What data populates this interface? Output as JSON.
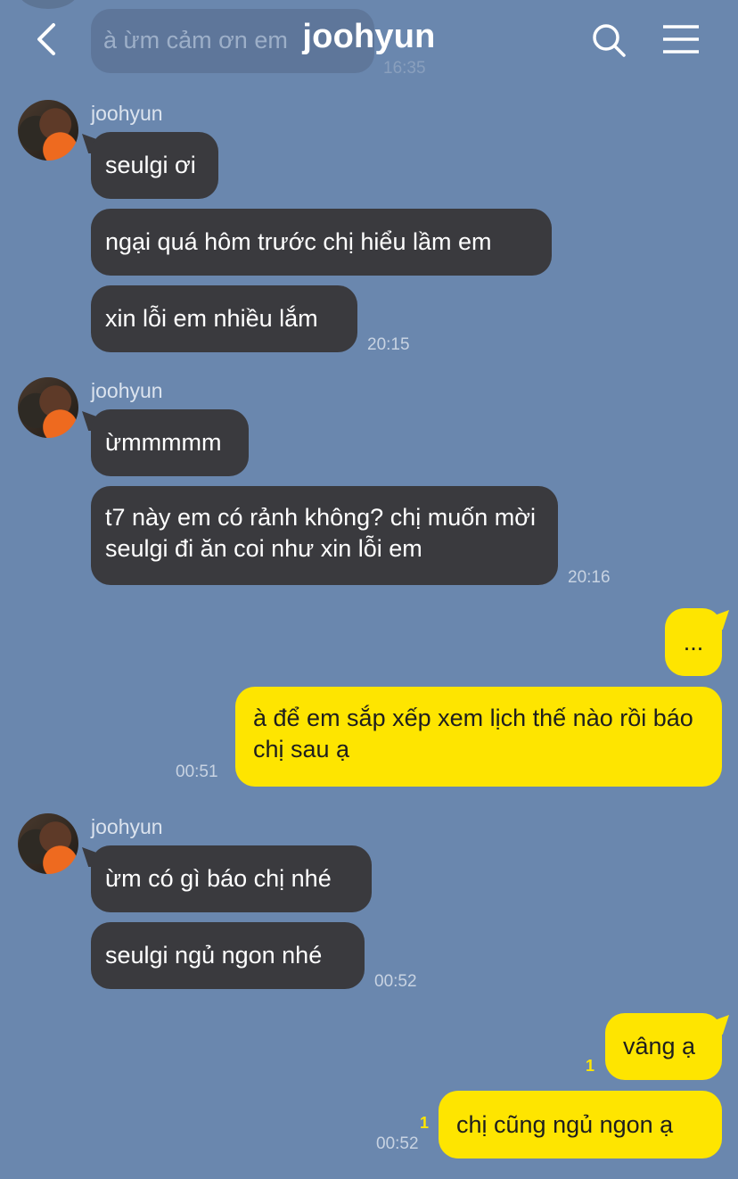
{
  "header": {
    "title": "joohyun",
    "back_icon": "chevron-left-icon",
    "search_icon": "search-icon",
    "menu_icon": "hamburger-menu-icon"
  },
  "ghost": {
    "text": "à ừm cảm ơn em",
    "time": "16:35"
  },
  "groups": [
    {
      "sender": "joohyun",
      "messages": [
        "seulgi ơi",
        "ngại quá hôm trước chị hiểu lầm em",
        "xin lỗi em nhiều lắm"
      ],
      "time": "20:15"
    },
    {
      "sender": "joohyun",
      "messages": [
        "ừmmmmm",
        "t7 này em có rảnh không? chị muốn mời seulgi đi ăn coi như xin lỗi em"
      ],
      "time": "20:16"
    },
    {
      "outgoing": true,
      "messages": [
        "...",
        "à để em sắp xếp xem lịch thế nào rồi báo chị sau ạ"
      ],
      "time": "00:51"
    },
    {
      "sender": "joohyun",
      "messages": [
        "ừm có gì báo chị nhé",
        "seulgi ngủ ngon nhé"
      ],
      "time": "00:52"
    },
    {
      "outgoing": true,
      "messages": [
        "vâng ạ",
        "chị cũng ngủ ngon ạ"
      ],
      "unread": [
        "1",
        "1"
      ],
      "time": "00:52"
    }
  ],
  "colors": {
    "background": "#6a87ae",
    "incoming_bubble": "#3a3a3e",
    "outgoing_bubble": "#fee500"
  }
}
